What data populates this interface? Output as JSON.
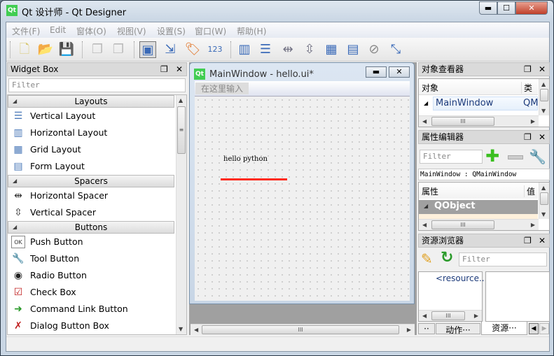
{
  "window": {
    "title": "Qt 设计师 - Qt Designer",
    "logo": "Qt",
    "min": "▬",
    "max": "☐",
    "close": "✕"
  },
  "menubar": [
    "文件(F)",
    "Edit",
    "窗体(O)",
    "视图(V)",
    "设置(S)",
    "窗口(W)",
    "帮助(H)"
  ],
  "toolbar": {
    "icons": [
      "new-file-icon",
      "open-folder-icon",
      "save-icon",
      "copy-icon",
      "paste-icon",
      "edit-widgets-icon",
      "edit-signals-icon",
      "edit-buddies-icon",
      "edit-tab-order-icon",
      "layout-horizontal-icon",
      "layout-vertical-icon",
      "layout-splitter-h-icon",
      "layout-splitter-v-icon",
      "layout-grid-icon",
      "layout-form-icon",
      "break-layout-icon",
      "adjust-size-icon"
    ]
  },
  "widget_box": {
    "title": "Widget Box",
    "filter_placeholder": "Filter",
    "categories": [
      {
        "label": "Layouts",
        "items": [
          "Vertical Layout",
          "Horizontal Layout",
          "Grid Layout",
          "Form Layout"
        ]
      },
      {
        "label": "Spacers",
        "items": [
          "Horizontal Spacer",
          "Vertical Spacer"
        ]
      },
      {
        "label": "Buttons",
        "items": [
          "Push Button",
          "Tool Button",
          "Radio Button",
          "Check Box",
          "Command Link Button",
          "Dialog Button Box"
        ]
      }
    ]
  },
  "form": {
    "title": "MainWindow - hello.ui*",
    "logo": "Qt",
    "menu_placeholder": "在这里输入",
    "label": "hello python",
    "line_color": "#ff2a1a"
  },
  "object_inspector": {
    "title": "对象查看器",
    "col_object": "对象",
    "col_class": "类",
    "rows": [
      {
        "name": "MainWindow",
        "class": "QM"
      }
    ]
  },
  "property_editor": {
    "title": "属性编辑器",
    "filter_placeholder": "Filter",
    "object_label": "MainWindow : QMainWindow",
    "col_property": "属性",
    "col_value": "值",
    "group": "QObject"
  },
  "resource_browser": {
    "title": "资源浏览器",
    "filter_placeholder": "Filter",
    "root": "<resource..."
  },
  "bottom_tabs": [
    "··",
    "动作···",
    "资源···"
  ]
}
